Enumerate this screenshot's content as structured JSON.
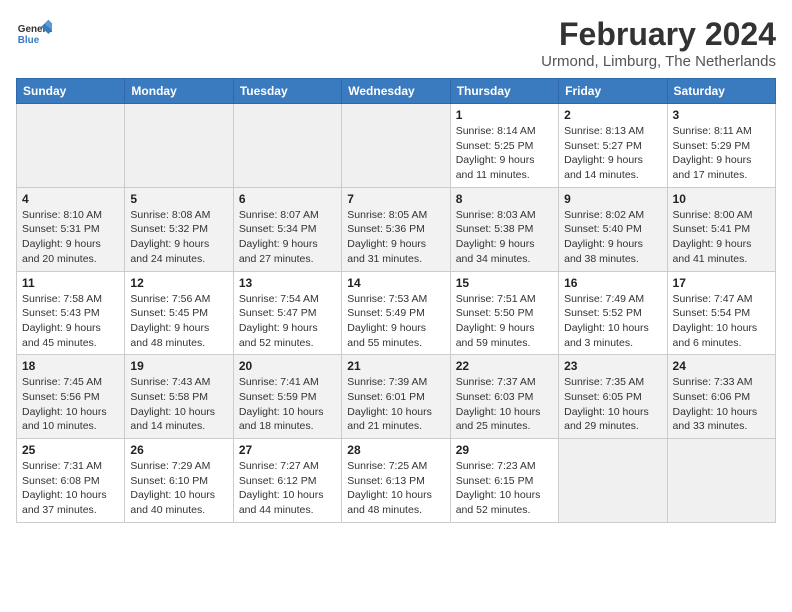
{
  "header": {
    "logo_general": "General",
    "logo_blue": "Blue",
    "month_year": "February 2024",
    "location": "Urmond, Limburg, The Netherlands"
  },
  "weekdays": [
    "Sunday",
    "Monday",
    "Tuesday",
    "Wednesday",
    "Thursday",
    "Friday",
    "Saturday"
  ],
  "weeks": [
    [
      {
        "day": "",
        "detail": ""
      },
      {
        "day": "",
        "detail": ""
      },
      {
        "day": "",
        "detail": ""
      },
      {
        "day": "",
        "detail": ""
      },
      {
        "day": "1",
        "detail": "Sunrise: 8:14 AM\nSunset: 5:25 PM\nDaylight: 9 hours\nand 11 minutes."
      },
      {
        "day": "2",
        "detail": "Sunrise: 8:13 AM\nSunset: 5:27 PM\nDaylight: 9 hours\nand 14 minutes."
      },
      {
        "day": "3",
        "detail": "Sunrise: 8:11 AM\nSunset: 5:29 PM\nDaylight: 9 hours\nand 17 minutes."
      }
    ],
    [
      {
        "day": "4",
        "detail": "Sunrise: 8:10 AM\nSunset: 5:31 PM\nDaylight: 9 hours\nand 20 minutes."
      },
      {
        "day": "5",
        "detail": "Sunrise: 8:08 AM\nSunset: 5:32 PM\nDaylight: 9 hours\nand 24 minutes."
      },
      {
        "day": "6",
        "detail": "Sunrise: 8:07 AM\nSunset: 5:34 PM\nDaylight: 9 hours\nand 27 minutes."
      },
      {
        "day": "7",
        "detail": "Sunrise: 8:05 AM\nSunset: 5:36 PM\nDaylight: 9 hours\nand 31 minutes."
      },
      {
        "day": "8",
        "detail": "Sunrise: 8:03 AM\nSunset: 5:38 PM\nDaylight: 9 hours\nand 34 minutes."
      },
      {
        "day": "9",
        "detail": "Sunrise: 8:02 AM\nSunset: 5:40 PM\nDaylight: 9 hours\nand 38 minutes."
      },
      {
        "day": "10",
        "detail": "Sunrise: 8:00 AM\nSunset: 5:41 PM\nDaylight: 9 hours\nand 41 minutes."
      }
    ],
    [
      {
        "day": "11",
        "detail": "Sunrise: 7:58 AM\nSunset: 5:43 PM\nDaylight: 9 hours\nand 45 minutes."
      },
      {
        "day": "12",
        "detail": "Sunrise: 7:56 AM\nSunset: 5:45 PM\nDaylight: 9 hours\nand 48 minutes."
      },
      {
        "day": "13",
        "detail": "Sunrise: 7:54 AM\nSunset: 5:47 PM\nDaylight: 9 hours\nand 52 minutes."
      },
      {
        "day": "14",
        "detail": "Sunrise: 7:53 AM\nSunset: 5:49 PM\nDaylight: 9 hours\nand 55 minutes."
      },
      {
        "day": "15",
        "detail": "Sunrise: 7:51 AM\nSunset: 5:50 PM\nDaylight: 9 hours\nand 59 minutes."
      },
      {
        "day": "16",
        "detail": "Sunrise: 7:49 AM\nSunset: 5:52 PM\nDaylight: 10 hours\nand 3 minutes."
      },
      {
        "day": "17",
        "detail": "Sunrise: 7:47 AM\nSunset: 5:54 PM\nDaylight: 10 hours\nand 6 minutes."
      }
    ],
    [
      {
        "day": "18",
        "detail": "Sunrise: 7:45 AM\nSunset: 5:56 PM\nDaylight: 10 hours\nand 10 minutes."
      },
      {
        "day": "19",
        "detail": "Sunrise: 7:43 AM\nSunset: 5:58 PM\nDaylight: 10 hours\nand 14 minutes."
      },
      {
        "day": "20",
        "detail": "Sunrise: 7:41 AM\nSunset: 5:59 PM\nDaylight: 10 hours\nand 18 minutes."
      },
      {
        "day": "21",
        "detail": "Sunrise: 7:39 AM\nSunset: 6:01 PM\nDaylight: 10 hours\nand 21 minutes."
      },
      {
        "day": "22",
        "detail": "Sunrise: 7:37 AM\nSunset: 6:03 PM\nDaylight: 10 hours\nand 25 minutes."
      },
      {
        "day": "23",
        "detail": "Sunrise: 7:35 AM\nSunset: 6:05 PM\nDaylight: 10 hours\nand 29 minutes."
      },
      {
        "day": "24",
        "detail": "Sunrise: 7:33 AM\nSunset: 6:06 PM\nDaylight: 10 hours\nand 33 minutes."
      }
    ],
    [
      {
        "day": "25",
        "detail": "Sunrise: 7:31 AM\nSunset: 6:08 PM\nDaylight: 10 hours\nand 37 minutes."
      },
      {
        "day": "26",
        "detail": "Sunrise: 7:29 AM\nSunset: 6:10 PM\nDaylight: 10 hours\nand 40 minutes."
      },
      {
        "day": "27",
        "detail": "Sunrise: 7:27 AM\nSunset: 6:12 PM\nDaylight: 10 hours\nand 44 minutes."
      },
      {
        "day": "28",
        "detail": "Sunrise: 7:25 AM\nSunset: 6:13 PM\nDaylight: 10 hours\nand 48 minutes."
      },
      {
        "day": "29",
        "detail": "Sunrise: 7:23 AM\nSunset: 6:15 PM\nDaylight: 10 hours\nand 52 minutes."
      },
      {
        "day": "",
        "detail": ""
      },
      {
        "day": "",
        "detail": ""
      }
    ]
  ]
}
